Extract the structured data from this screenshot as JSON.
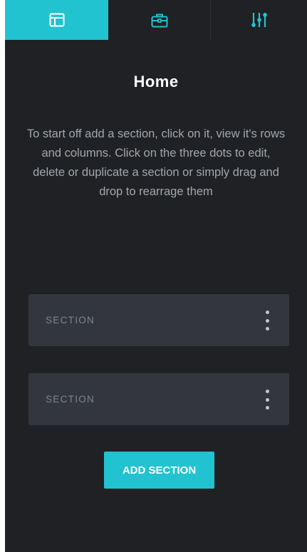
{
  "tabs": [
    {
      "name": "layout",
      "icon": "layout-icon",
      "active": true
    },
    {
      "name": "widgets",
      "icon": "briefcase-icon",
      "active": false
    },
    {
      "name": "settings",
      "icon": "sliders-icon",
      "active": false
    }
  ],
  "page": {
    "title": "Home",
    "description": "To start off add a section, click on it, view it's rows and columns. Click on the three dots to edit, delete or duplicate a section or simply drag and drop to rearrage them"
  },
  "sections": [
    {
      "label": "SECTION",
      "menu_icon": "more-vertical-icon"
    },
    {
      "label": "SECTION",
      "menu_icon": "more-vertical-icon"
    }
  ],
  "add_button": {
    "label": "ADD SECTION"
  },
  "colors": {
    "accent": "#21c3d0",
    "panel_bg": "#1f2124",
    "card_bg": "#33373d",
    "text_muted": "#a3a7ac",
    "icon_teal": "#21c3d0"
  }
}
